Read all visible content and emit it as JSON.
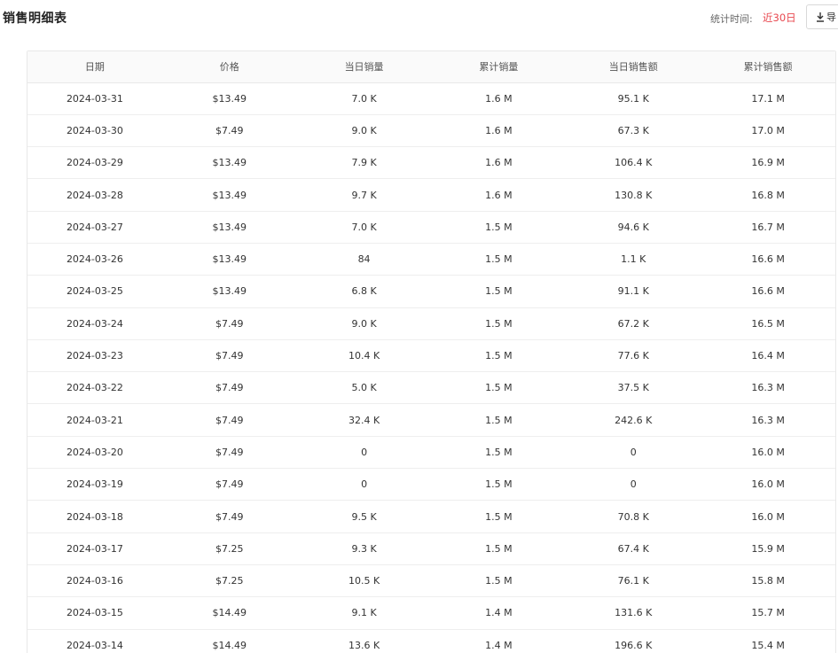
{
  "header": {
    "title": "销售明细表",
    "stat_label": "统计时间:",
    "range": "近30日",
    "export_label": "导"
  },
  "table": {
    "columns": [
      "日期",
      "价格",
      "当日销量",
      "累计销量",
      "当日销售额",
      "累计销售额"
    ],
    "rows": [
      [
        "2024-03-31",
        "$13.49",
        "7.0 K",
        "1.6 M",
        "95.1 K",
        "17.1 M"
      ],
      [
        "2024-03-30",
        "$7.49",
        "9.0 K",
        "1.6 M",
        "67.3 K",
        "17.0 M"
      ],
      [
        "2024-03-29",
        "$13.49",
        "7.9 K",
        "1.6 M",
        "106.4 K",
        "16.9 M"
      ],
      [
        "2024-03-28",
        "$13.49",
        "9.7 K",
        "1.6 M",
        "130.8 K",
        "16.8 M"
      ],
      [
        "2024-03-27",
        "$13.49",
        "7.0 K",
        "1.5 M",
        "94.6 K",
        "16.7 M"
      ],
      [
        "2024-03-26",
        "$13.49",
        "84",
        "1.5 M",
        "1.1 K",
        "16.6 M"
      ],
      [
        "2024-03-25",
        "$13.49",
        "6.8 K",
        "1.5 M",
        "91.1 K",
        "16.6 M"
      ],
      [
        "2024-03-24",
        "$7.49",
        "9.0 K",
        "1.5 M",
        "67.2 K",
        "16.5 M"
      ],
      [
        "2024-03-23",
        "$7.49",
        "10.4 K",
        "1.5 M",
        "77.6 K",
        "16.4 M"
      ],
      [
        "2024-03-22",
        "$7.49",
        "5.0 K",
        "1.5 M",
        "37.5 K",
        "16.3 M"
      ],
      [
        "2024-03-21",
        "$7.49",
        "32.4 K",
        "1.5 M",
        "242.6 K",
        "16.3 M"
      ],
      [
        "2024-03-20",
        "$7.49",
        "0",
        "1.5 M",
        "0",
        "16.0 M"
      ],
      [
        "2024-03-19",
        "$7.49",
        "0",
        "1.5 M",
        "0",
        "16.0 M"
      ],
      [
        "2024-03-18",
        "$7.49",
        "9.5 K",
        "1.5 M",
        "70.8 K",
        "16.0 M"
      ],
      [
        "2024-03-17",
        "$7.25",
        "9.3 K",
        "1.5 M",
        "67.4 K",
        "15.9 M"
      ],
      [
        "2024-03-16",
        "$7.25",
        "10.5 K",
        "1.5 M",
        "76.1 K",
        "15.8 M"
      ],
      [
        "2024-03-15",
        "$14.49",
        "9.1 K",
        "1.4 M",
        "131.6 K",
        "15.7 M"
      ],
      [
        "2024-03-14",
        "$14.49",
        "13.6 K",
        "1.4 M",
        "196.6 K",
        "15.4 M"
      ]
    ]
  }
}
